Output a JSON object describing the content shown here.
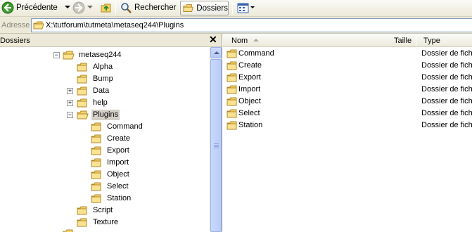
{
  "toolbar": {
    "back_label": "Précédente",
    "search_label": "Rechercher",
    "folders_label": "Dossiers"
  },
  "address": {
    "label": "Adresse",
    "value": "X:\\tutforum\\tutmeta\\metaseq244\\Plugins"
  },
  "folders_pane": {
    "title": "Dossiers",
    "close": "✕",
    "tree": [
      {
        "label": "metaseq244",
        "expander": "−"
      },
      {
        "label": "Alpha",
        "expander": ""
      },
      {
        "label": "Bump",
        "expander": ""
      },
      {
        "label": "Data",
        "expander": "+"
      },
      {
        "label": "help",
        "expander": "+"
      },
      {
        "label": "Plugins",
        "expander": "−"
      },
      {
        "label": "Command",
        "expander": ""
      },
      {
        "label": "Create",
        "expander": ""
      },
      {
        "label": "Export",
        "expander": ""
      },
      {
        "label": "Import",
        "expander": ""
      },
      {
        "label": "Object",
        "expander": ""
      },
      {
        "label": "Select",
        "expander": ""
      },
      {
        "label": "Station",
        "expander": ""
      },
      {
        "label": "Script",
        "expander": ""
      },
      {
        "label": "Texture",
        "expander": ""
      }
    ]
  },
  "file_list": {
    "columns": {
      "name": "Nom",
      "size": "Taille",
      "type": "Type"
    },
    "rows": [
      {
        "name": "Command",
        "type": "Dossier de fichiers"
      },
      {
        "name": "Create",
        "type": "Dossier de fichiers"
      },
      {
        "name": "Export",
        "type": "Dossier de fichiers"
      },
      {
        "name": "Import",
        "type": "Dossier de fichiers"
      },
      {
        "name": "Object",
        "type": "Dossier de fichiers"
      },
      {
        "name": "Select",
        "type": "Dossier de fichiers"
      },
      {
        "name": "Station",
        "type": "Dossier de fichiers"
      }
    ]
  },
  "colors": {
    "toolbar_bg": "#ece9d8",
    "folder_yellow": "#f5d36a",
    "selected_bg": "#d4d0c8",
    "scroll_blue": "#b9cdf7"
  }
}
